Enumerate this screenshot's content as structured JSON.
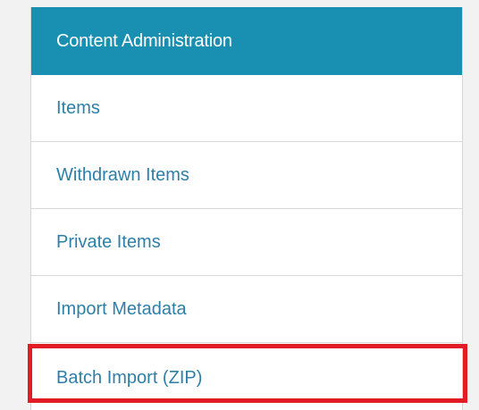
{
  "panel": {
    "header": "Content Administration",
    "items": [
      {
        "label": "Items"
      },
      {
        "label": "Withdrawn Items"
      },
      {
        "label": "Private Items"
      },
      {
        "label": "Import Metadata"
      },
      {
        "label": "Batch Import (ZIP)"
      }
    ],
    "colors": {
      "header_background": "#1990b1",
      "link_text": "#2d7fa8",
      "highlight_border": "#e21c24"
    }
  }
}
